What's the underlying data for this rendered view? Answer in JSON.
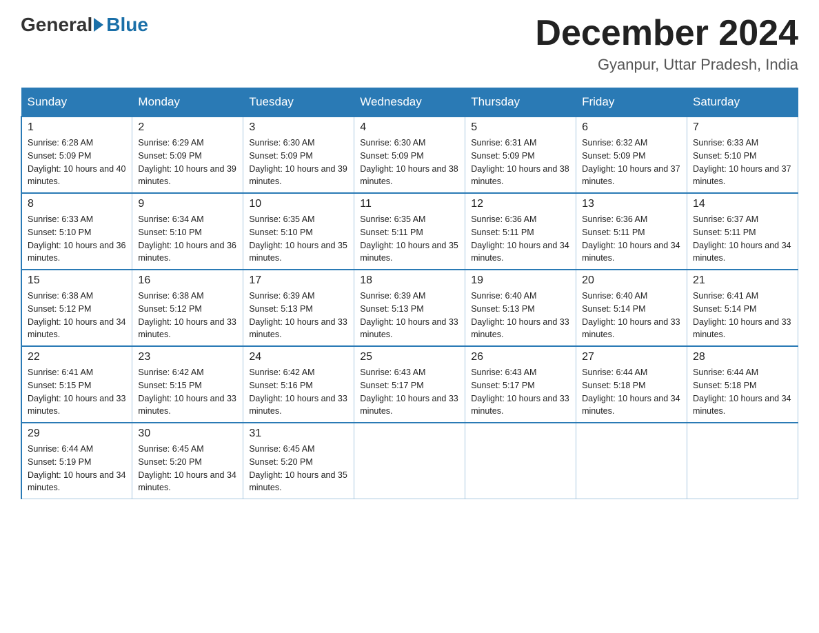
{
  "logo": {
    "general": "General",
    "arrow_color": "#1a6fa8",
    "blue": "Blue"
  },
  "title": {
    "month": "December 2024",
    "location": "Gyanpur, Uttar Pradesh, India"
  },
  "days_of_week": [
    "Sunday",
    "Monday",
    "Tuesday",
    "Wednesday",
    "Thursday",
    "Friday",
    "Saturday"
  ],
  "weeks": [
    [
      {
        "day": "1",
        "sunrise": "6:28 AM",
        "sunset": "5:09 PM",
        "daylight": "10 hours and 40 minutes."
      },
      {
        "day": "2",
        "sunrise": "6:29 AM",
        "sunset": "5:09 PM",
        "daylight": "10 hours and 39 minutes."
      },
      {
        "day": "3",
        "sunrise": "6:30 AM",
        "sunset": "5:09 PM",
        "daylight": "10 hours and 39 minutes."
      },
      {
        "day": "4",
        "sunrise": "6:30 AM",
        "sunset": "5:09 PM",
        "daylight": "10 hours and 38 minutes."
      },
      {
        "day": "5",
        "sunrise": "6:31 AM",
        "sunset": "5:09 PM",
        "daylight": "10 hours and 38 minutes."
      },
      {
        "day": "6",
        "sunrise": "6:32 AM",
        "sunset": "5:09 PM",
        "daylight": "10 hours and 37 minutes."
      },
      {
        "day": "7",
        "sunrise": "6:33 AM",
        "sunset": "5:10 PM",
        "daylight": "10 hours and 37 minutes."
      }
    ],
    [
      {
        "day": "8",
        "sunrise": "6:33 AM",
        "sunset": "5:10 PM",
        "daylight": "10 hours and 36 minutes."
      },
      {
        "day": "9",
        "sunrise": "6:34 AM",
        "sunset": "5:10 PM",
        "daylight": "10 hours and 36 minutes."
      },
      {
        "day": "10",
        "sunrise": "6:35 AM",
        "sunset": "5:10 PM",
        "daylight": "10 hours and 35 minutes."
      },
      {
        "day": "11",
        "sunrise": "6:35 AM",
        "sunset": "5:11 PM",
        "daylight": "10 hours and 35 minutes."
      },
      {
        "day": "12",
        "sunrise": "6:36 AM",
        "sunset": "5:11 PM",
        "daylight": "10 hours and 34 minutes."
      },
      {
        "day": "13",
        "sunrise": "6:36 AM",
        "sunset": "5:11 PM",
        "daylight": "10 hours and 34 minutes."
      },
      {
        "day": "14",
        "sunrise": "6:37 AM",
        "sunset": "5:11 PM",
        "daylight": "10 hours and 34 minutes."
      }
    ],
    [
      {
        "day": "15",
        "sunrise": "6:38 AM",
        "sunset": "5:12 PM",
        "daylight": "10 hours and 34 minutes."
      },
      {
        "day": "16",
        "sunrise": "6:38 AM",
        "sunset": "5:12 PM",
        "daylight": "10 hours and 33 minutes."
      },
      {
        "day": "17",
        "sunrise": "6:39 AM",
        "sunset": "5:13 PM",
        "daylight": "10 hours and 33 minutes."
      },
      {
        "day": "18",
        "sunrise": "6:39 AM",
        "sunset": "5:13 PM",
        "daylight": "10 hours and 33 minutes."
      },
      {
        "day": "19",
        "sunrise": "6:40 AM",
        "sunset": "5:13 PM",
        "daylight": "10 hours and 33 minutes."
      },
      {
        "day": "20",
        "sunrise": "6:40 AM",
        "sunset": "5:14 PM",
        "daylight": "10 hours and 33 minutes."
      },
      {
        "day": "21",
        "sunrise": "6:41 AM",
        "sunset": "5:14 PM",
        "daylight": "10 hours and 33 minutes."
      }
    ],
    [
      {
        "day": "22",
        "sunrise": "6:41 AM",
        "sunset": "5:15 PM",
        "daylight": "10 hours and 33 minutes."
      },
      {
        "day": "23",
        "sunrise": "6:42 AM",
        "sunset": "5:15 PM",
        "daylight": "10 hours and 33 minutes."
      },
      {
        "day": "24",
        "sunrise": "6:42 AM",
        "sunset": "5:16 PM",
        "daylight": "10 hours and 33 minutes."
      },
      {
        "day": "25",
        "sunrise": "6:43 AM",
        "sunset": "5:17 PM",
        "daylight": "10 hours and 33 minutes."
      },
      {
        "day": "26",
        "sunrise": "6:43 AM",
        "sunset": "5:17 PM",
        "daylight": "10 hours and 33 minutes."
      },
      {
        "day": "27",
        "sunrise": "6:44 AM",
        "sunset": "5:18 PM",
        "daylight": "10 hours and 34 minutes."
      },
      {
        "day": "28",
        "sunrise": "6:44 AM",
        "sunset": "5:18 PM",
        "daylight": "10 hours and 34 minutes."
      }
    ],
    [
      {
        "day": "29",
        "sunrise": "6:44 AM",
        "sunset": "5:19 PM",
        "daylight": "10 hours and 34 minutes."
      },
      {
        "day": "30",
        "sunrise": "6:45 AM",
        "sunset": "5:20 PM",
        "daylight": "10 hours and 34 minutes."
      },
      {
        "day": "31",
        "sunrise": "6:45 AM",
        "sunset": "5:20 PM",
        "daylight": "10 hours and 35 minutes."
      },
      null,
      null,
      null,
      null
    ]
  ]
}
